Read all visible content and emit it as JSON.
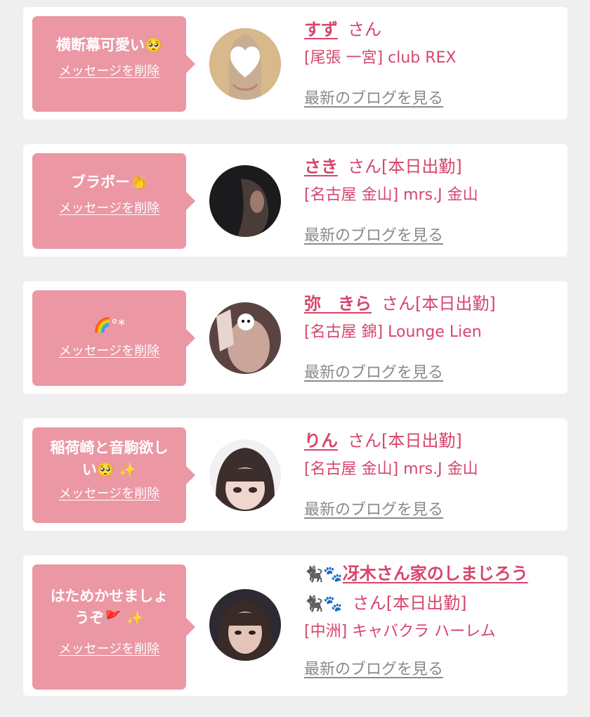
{
  "cards": [
    {
      "message": "横断幕可愛い",
      "message_emoji": "🥺",
      "delete_label": "メッセージを削除",
      "name": "すず",
      "suffix": "さん",
      "shop": "[尾張 一宮] club REX",
      "blog_label": "最新のブログを見る"
    },
    {
      "message": "ブラボー",
      "message_emoji": "👏",
      "delete_label": "メッセージを削除",
      "name": "さき",
      "suffix": "さん[本日出勤]",
      "shop": "[名古屋 金山] mrs.J 金山",
      "blog_label": "最新のブログを見る"
    },
    {
      "message": "",
      "message_emoji": "🌈°*",
      "delete_label": "メッセージを削除",
      "name": "弥　きら",
      "suffix": "さん[本日出勤]",
      "shop": "[名古屋 錦] Lounge Lien",
      "blog_label": "最新のブログを見る"
    },
    {
      "message_line1": "稲荷崎と音駒欲し",
      "message_line2": "い",
      "message_emoji": "🥺 ✨",
      "delete_label": "メッセージを削除",
      "name": "りん",
      "suffix": "さん[本日出勤]",
      "shop": "[名古屋 金山] mrs.J 金山",
      "blog_label": "最新のブログを見る"
    },
    {
      "message_line1": "はためかせましょ",
      "message_line2": "うぞ",
      "message_emoji": "🚩 ✨",
      "delete_label": "メッセージを削除",
      "name_emoji": "🐈‍⬛🐾",
      "name": "冴木さん家のしまじろう",
      "name_emoji_2": "🐈‍⬛🐾",
      "suffix": "さん[本日出勤]",
      "shop": "[中洲] キャバクラ ハーレム",
      "blog_label": "最新のブログを見る"
    }
  ],
  "colors": {
    "accent_pink": "#eb97a4",
    "name_pink": "#d6456c",
    "link_gray": "#8a8a8a",
    "background": "#efefef"
  }
}
